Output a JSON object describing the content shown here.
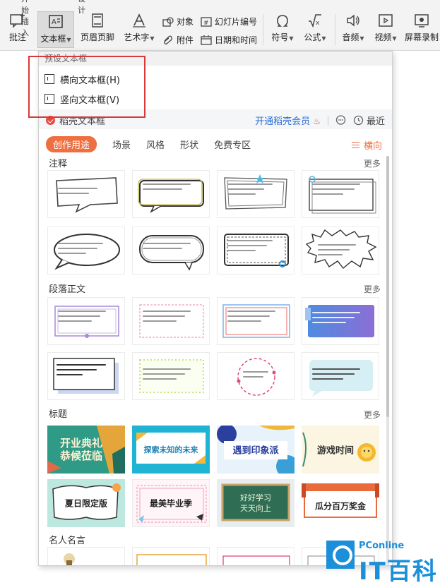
{
  "ribbon": {
    "top_tabs": [
      "开始插入",
      "设计"
    ],
    "tools": {
      "comment": "批注",
      "textbox": "文本框",
      "header_footer": "页眉页脚",
      "art_text": "艺术字",
      "object": "对象",
      "attachment": "附件",
      "slide_number": "幻灯片编号",
      "date_time": "日期和时间",
      "symbol": "符号",
      "formula": "公式",
      "audio": "音频",
      "video": "视频",
      "screen_record": "屏幕录制"
    }
  },
  "panel": {
    "preset_header": "预设文本框",
    "preset_items": [
      "横向文本框(H)",
      "竖向文本框(V)"
    ],
    "daoke": {
      "title": "稻壳文本框",
      "vip_link": "开通稻壳会员",
      "recent": "最近"
    },
    "categories": [
      "创作用途",
      "场景",
      "风格",
      "形状",
      "免费专区"
    ],
    "orientation": "横向",
    "more_label": "更多",
    "sections": [
      {
        "title": "注释"
      },
      {
        "title": "段落正文"
      },
      {
        "title": "标题",
        "cards": [
          "开业典礼\n恭候莅临",
          "探索未知的未来",
          "遇到印象派",
          "游戏时间",
          "夏日限定版",
          "最美毕业季",
          "好好学习\n天天向上",
          "瓜分百万奖金"
        ]
      },
      {
        "title": "名人名言"
      }
    ]
  },
  "watermark": {
    "brand": "PConline",
    "name": "IT百科"
  },
  "colors": {
    "accent_orange": "#ee6f3f",
    "highlight_red": "#d9383a",
    "vip_blue": "#2f6fd6",
    "watermark_blue": "#1b8fd8"
  }
}
